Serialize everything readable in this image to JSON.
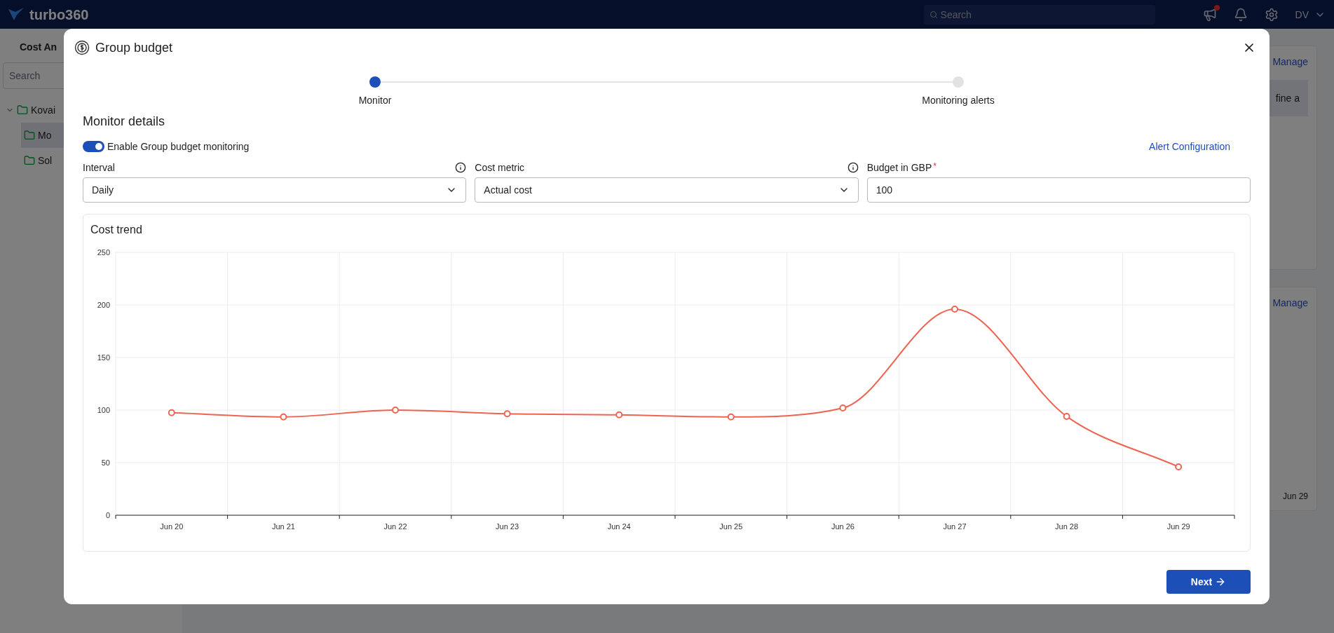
{
  "app": {
    "logo_text": "turbo360",
    "search_placeholder": "Search",
    "avatar": "DV",
    "notification_badge": true,
    "sidebar": {
      "title": "Cost An",
      "search_placeholder": "Search",
      "tree": [
        {
          "label": "Kovai",
          "expanded": true,
          "selected": false,
          "children": [
            {
              "label": "Mo",
              "selected": true
            },
            {
              "label": "Sol",
              "selected": false
            }
          ]
        }
      ]
    },
    "right_panels": [
      {
        "link": "Manage",
        "text": "fine a"
      },
      {
        "link": "Manage",
        "axis_label": "Jun 29"
      }
    ]
  },
  "dialog": {
    "title": "Group budget",
    "steps": [
      {
        "label": "Monitor",
        "selected": true
      },
      {
        "label": "Monitoring alerts",
        "selected": false
      }
    ],
    "section_title": "Monitor details",
    "toggle": {
      "label": "Enable Group budget monitoring",
      "on": true
    },
    "alert_link": "Alert Configuration",
    "fields": [
      {
        "kind": "select",
        "label": "Interval",
        "info": true,
        "value": "Daily"
      },
      {
        "kind": "select",
        "label": "Cost metric",
        "info": true,
        "value": "Actual cost"
      },
      {
        "kind": "input",
        "label": "Budget in GBP",
        "required_mark": "*",
        "value": "100"
      }
    ],
    "chart": {
      "title": "Cost trend",
      "chart_data": {
        "type": "line",
        "grid": true,
        "categories": [
          "Jun 20",
          "Jun 21",
          "Jun 22",
          "Jun 23",
          "Jun 24",
          "Jun 25",
          "Jun 26",
          "Jun 27",
          "Jun 28",
          "Jun 29"
        ],
        "series": [
          {
            "color": "#ef6351",
            "marker": "circle",
            "values": [
              97.5,
              93.5,
              100,
              96.5,
              95.5,
              93.5,
              102,
              196,
              94,
              46
            ]
          }
        ],
        "ylim": [
          0,
          250
        ],
        "yticks": [
          0,
          50,
          100,
          150,
          200,
          250
        ]
      }
    },
    "next_button": "Next"
  }
}
